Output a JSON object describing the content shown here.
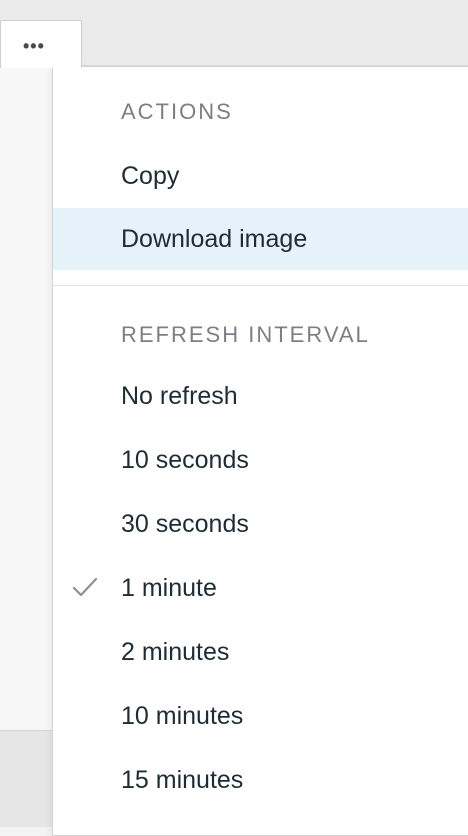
{
  "more_button": {
    "icon": "more-horizontal-icon",
    "glyph": "•••"
  },
  "menu": {
    "actions_header": "ACTIONS",
    "actions": [
      {
        "label": "Copy",
        "highlighted": false
      },
      {
        "label": "Download image",
        "highlighted": true
      }
    ],
    "refresh_header": "REFRESH INTERVAL",
    "refresh_options": [
      {
        "label": "No refresh",
        "selected": false
      },
      {
        "label": "10 seconds",
        "selected": false
      },
      {
        "label": "30 seconds",
        "selected": false
      },
      {
        "label": "1 minute",
        "selected": true
      },
      {
        "label": "2 minutes",
        "selected": false
      },
      {
        "label": "10 minutes",
        "selected": false
      },
      {
        "label": "15 minutes",
        "selected": false
      }
    ],
    "selected_icon": "checkmark-icon"
  },
  "colors": {
    "highlight": "#e6f2fa",
    "text": "#1f2c33",
    "header_text": "#7a7f85",
    "check": "#8a9096"
  }
}
